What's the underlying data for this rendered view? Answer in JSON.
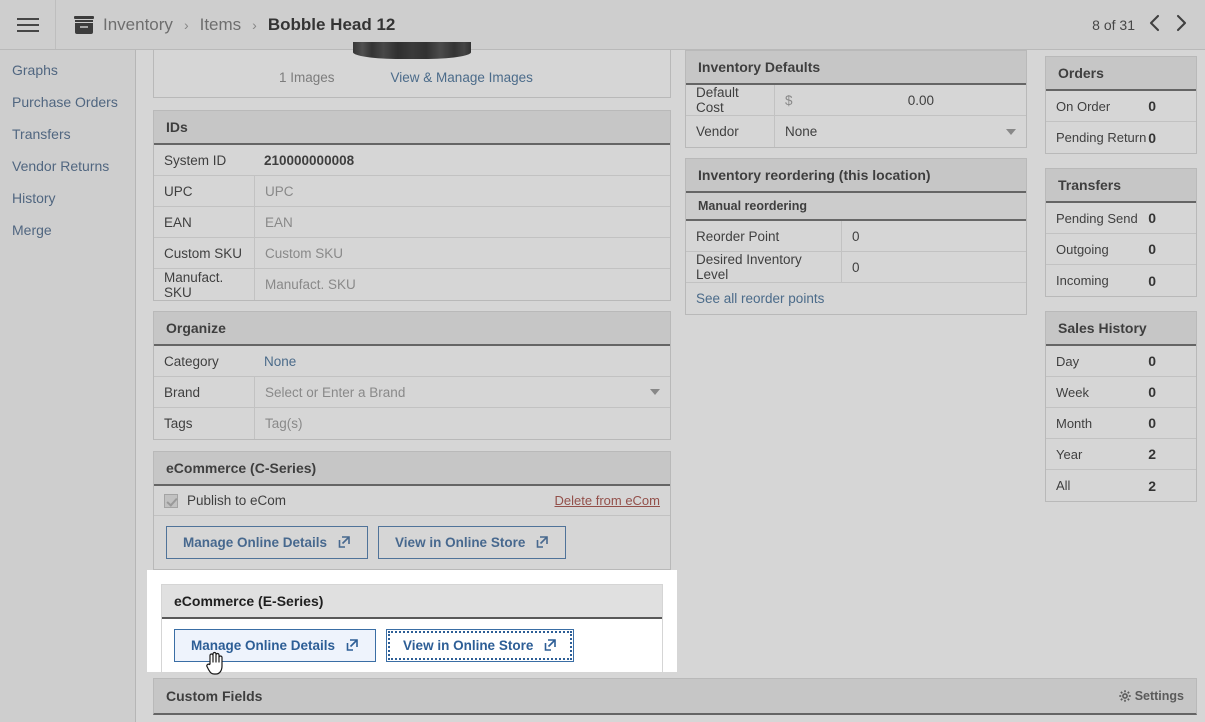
{
  "header": {
    "menu_icon": "hamburger-icon",
    "module_icon": "inventory-box-icon",
    "breadcrumb": [
      "Inventory",
      "Items",
      "Bobble Head 12"
    ],
    "separator": "›",
    "pager_count": "8 of 31",
    "prev_icon": "‹",
    "next_icon": "›"
  },
  "sidebar": {
    "items": [
      {
        "label": "Graphs"
      },
      {
        "label": "Purchase Orders"
      },
      {
        "label": "Transfers"
      },
      {
        "label": "Vendor Returns"
      },
      {
        "label": "History"
      },
      {
        "label": "Merge"
      }
    ]
  },
  "images": {
    "count_label": "1 Images",
    "manage_link": "View & Manage Images"
  },
  "ids": {
    "title": "IDs",
    "rows": [
      {
        "label": "System ID",
        "value": "210000000008",
        "placeholder": false
      },
      {
        "label": "UPC",
        "value": "UPC",
        "placeholder": true
      },
      {
        "label": "EAN",
        "value": "EAN",
        "placeholder": true
      },
      {
        "label": "Custom SKU",
        "value": "Custom SKU",
        "placeholder": true
      },
      {
        "label": "Manufact. SKU",
        "value": "Manufact. SKU",
        "placeholder": true
      }
    ]
  },
  "organize": {
    "title": "Organize",
    "category_label": "Category",
    "category_value": "None",
    "brand_label": "Brand",
    "brand_placeholder": "Select or Enter a Brand",
    "tags_label": "Tags",
    "tags_placeholder": "Tag(s)"
  },
  "ecom_c": {
    "title": "eCommerce (C-Series)",
    "publish_label": "Publish to eCom",
    "publish_checked": true,
    "delete_link": "Delete from eCom",
    "manage_button": "Manage Online Details",
    "view_button": "View in Online Store",
    "external_icon": "external-link-icon"
  },
  "ecom_e": {
    "title": "eCommerce (E-Series)",
    "manage_button": "Manage Online Details",
    "view_button": "View in Online Store",
    "external_icon": "external-link-icon"
  },
  "inventory_defaults": {
    "title": "Inventory Defaults",
    "cost_label": "Default Cost",
    "currency": "$",
    "cost_value": "0.00",
    "vendor_label": "Vendor",
    "vendor_value": "None"
  },
  "reordering": {
    "title": "Inventory reordering (this location)",
    "subtitle": "Manual reordering",
    "rows": [
      {
        "label": "Reorder Point",
        "value": "0"
      },
      {
        "label": "Desired Inventory Level",
        "value": "0"
      }
    ],
    "see_all_link": "See all reorder points"
  },
  "orders": {
    "title": "Orders",
    "rows": [
      {
        "label": "On Order",
        "value": "0"
      },
      {
        "label": "Pending Return",
        "value": "0"
      }
    ]
  },
  "transfers": {
    "title": "Transfers",
    "rows": [
      {
        "label": "Pending Send",
        "value": "0"
      },
      {
        "label": "Outgoing",
        "value": "0"
      },
      {
        "label": "Incoming",
        "value": "0"
      }
    ]
  },
  "sales_history": {
    "title": "Sales History",
    "rows": [
      {
        "label": "Day",
        "value": "0"
      },
      {
        "label": "Week",
        "value": "0"
      },
      {
        "label": "Month",
        "value": "0"
      },
      {
        "label": "Year",
        "value": "2"
      },
      {
        "label": "All",
        "value": "2"
      }
    ]
  },
  "custom_fields": {
    "title": "Custom Fields",
    "settings_label": "Settings",
    "settings_icon": "gear-icon"
  },
  "colors": {
    "link": "#33628f",
    "button_border": "#3a6ea5",
    "button_text": "#2d5e96",
    "danger": "#9c3a32",
    "panel_head_bg": "#e8e8e8",
    "page_bg": "#ffffff"
  }
}
